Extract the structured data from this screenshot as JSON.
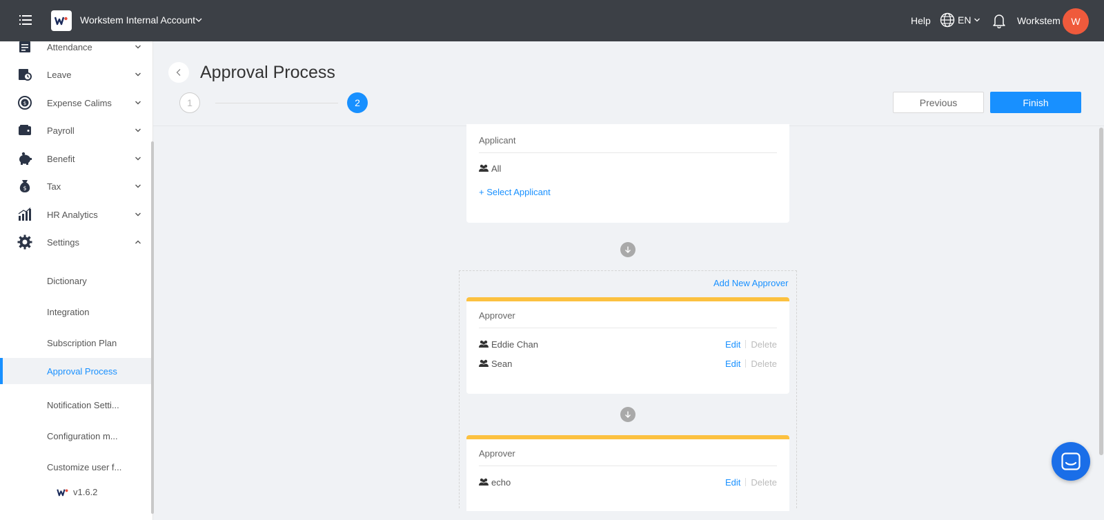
{
  "topbar": {
    "account_name": "Workstem Internal Account",
    "help": "Help",
    "language": "EN",
    "user_name": "Workstem",
    "avatar_initial": "W"
  },
  "sidebar": {
    "items": [
      {
        "label": "Attendance",
        "icon": "attendance-icon",
        "expanded": false
      },
      {
        "label": "Leave",
        "icon": "leave-icon",
        "expanded": false
      },
      {
        "label": "Expense Calims",
        "icon": "expense-icon",
        "expanded": false
      },
      {
        "label": "Payroll",
        "icon": "payroll-icon",
        "expanded": false
      },
      {
        "label": "Benefit",
        "icon": "benefit-icon",
        "expanded": false
      },
      {
        "label": "Tax",
        "icon": "tax-icon",
        "expanded": false
      },
      {
        "label": "HR Analytics",
        "icon": "analytics-icon",
        "expanded": false
      },
      {
        "label": "Settings",
        "icon": "gear-icon",
        "expanded": true
      }
    ],
    "sub_items": [
      {
        "label": "Dictionary",
        "active": false
      },
      {
        "label": "Integration",
        "active": false
      },
      {
        "label": "Subscription Plan",
        "active": false
      },
      {
        "label": "Approval Process",
        "active": true
      },
      {
        "label": "Notification Setti...",
        "active": false
      },
      {
        "label": "Configuration m...",
        "active": false
      },
      {
        "label": "Customize user f...",
        "active": false
      }
    ],
    "version": "v1.6.2"
  },
  "header": {
    "title": "Approval Process",
    "steps": [
      "1",
      "2"
    ],
    "current_step": 2,
    "previous_label": "Previous",
    "finish_label": "Finish"
  },
  "applicant_card": {
    "title": "Applicant",
    "members": [
      "All"
    ],
    "select_label": "+ Select Applicant"
  },
  "approvers": {
    "add_label": "Add New Approver",
    "cards": [
      {
        "title": "Approver",
        "members": [
          "Eddie Chan",
          "Sean"
        ]
      },
      {
        "title": "Approver",
        "members": [
          "echo"
        ]
      }
    ],
    "edit_label": "Edit",
    "delete_label": "Delete"
  },
  "colors": {
    "topbar": "#3c4046",
    "accent": "#1890ff",
    "approver_bar": "#fcc140",
    "avatar": "#ef5a3c",
    "chat": "#1a6ee8"
  }
}
